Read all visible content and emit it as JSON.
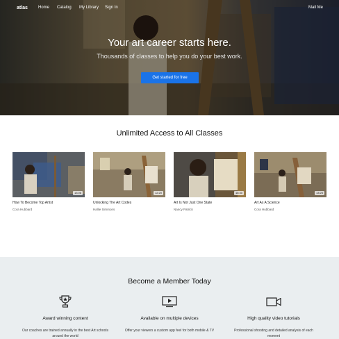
{
  "nav": {
    "brand": "atlas",
    "links": [
      "Home",
      "Catalog",
      "My Library",
      "Sign In"
    ],
    "right_link": "Mail Me"
  },
  "hero": {
    "title": "Your art career starts here.",
    "subtitle": "Thousands of classes to help you do your best work.",
    "cta_label": "Get started for free"
  },
  "classes": {
    "title": "Unlimited Access to All Classes",
    "items": [
      {
        "title": "How To Become Top Artist",
        "author": "Cora Hubbard",
        "duration": "13:06"
      },
      {
        "title": "Unlocking The Art Codes",
        "author": "Hallie Simmons",
        "duration": "12:20"
      },
      {
        "title": "Art Is Not Just One State",
        "author": "Nancy Patrick",
        "duration": "16:30"
      },
      {
        "title": "Art As A Science",
        "author": "Cora Hubbard",
        "duration": "13:25"
      }
    ]
  },
  "membership": {
    "title": "Become a Member Today",
    "features": [
      {
        "icon": "trophy-icon",
        "title": "Award winning content",
        "description": "Our coaches are trained annually in the best Art schools around the world"
      },
      {
        "icon": "play-screen-icon",
        "title": "Available on multiple devices",
        "description": "Offer your viewers a custom app feel for both mobile & TV"
      },
      {
        "icon": "video-camera-icon",
        "title": "High quality video tutorials",
        "description": "Professional shooting and detailed analysis of each moment"
      }
    ]
  },
  "colors": {
    "cta": "#1a73e8",
    "member_bg": "#eaeef0"
  }
}
